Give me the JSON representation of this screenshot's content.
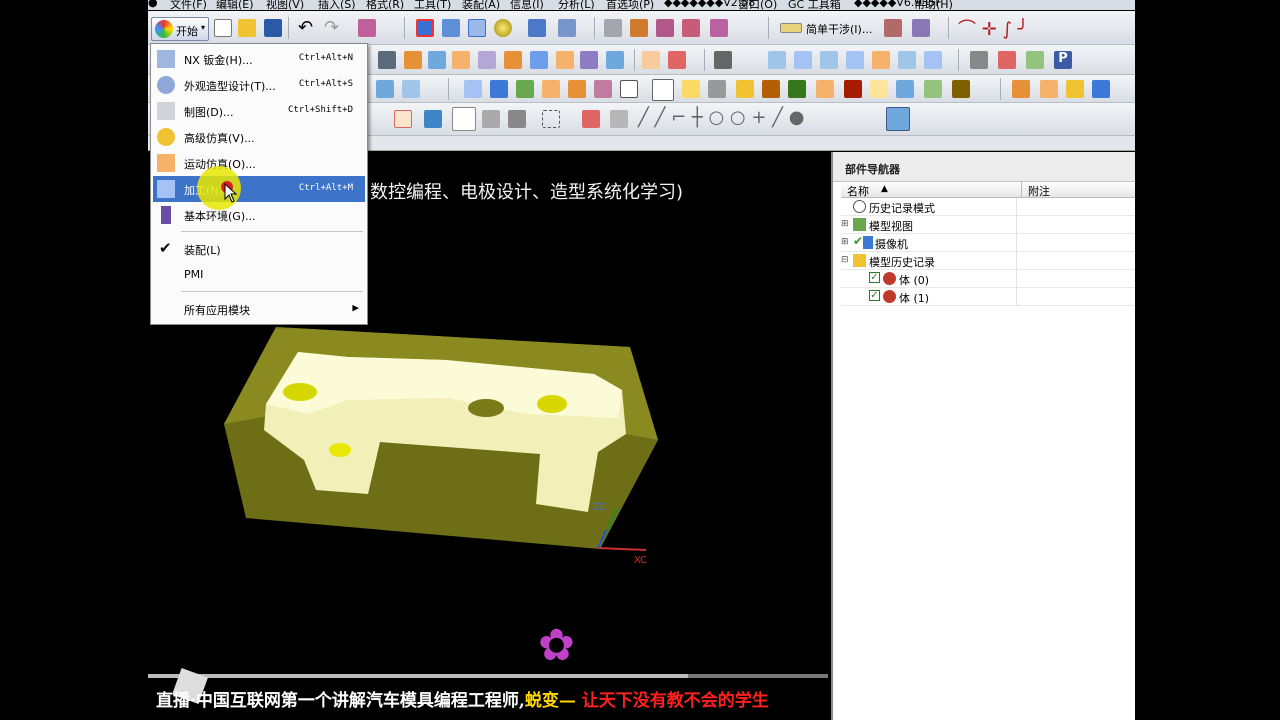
{
  "menubar": {
    "items": [
      "文件(F)",
      "编辑(E)",
      "视图(V)",
      "插入(S)",
      "格式(R)",
      "工具(T)",
      "装配(A)",
      "信息(I)",
      "分析(L)",
      "首选项(P)",
      "◆◆◆◆◆◆◆V2.58",
      "窗口(O)",
      "GC 工具箱",
      "◆◆◆◆◆V6.935F",
      "帮助(H)"
    ]
  },
  "toolbar": {
    "start_label": "开始",
    "selection_filter": "简单干涉(I)..."
  },
  "start_menu": {
    "items": [
      {
        "label": "NX 钣金(H)...",
        "shortcut": "Ctrl+Alt+N"
      },
      {
        "label": "外观造型设计(T)...",
        "shortcut": "Ctrl+Alt+S"
      },
      {
        "label": "制图(D)...",
        "shortcut": "Ctrl+Shift+D"
      },
      {
        "label": "高级仿真(V)...",
        "shortcut": ""
      },
      {
        "label": "运动仿真(O)...",
        "shortcut": ""
      },
      {
        "label": "加工(N)...",
        "shortcut": "Ctrl+Alt+M"
      },
      {
        "label": "基本环境(G)...",
        "shortcut": ""
      },
      {
        "label": "装配(L)",
        "shortcut": ""
      },
      {
        "label": "PMI",
        "shortcut": ""
      },
      {
        "label": "所有应用模块",
        "shortcut": ""
      }
    ],
    "submenu_arrow": "▶",
    "checkmark": "✔"
  },
  "viewport": {
    "title": "数控编程、电极设计、造型系统化学习)",
    "axis_x": "XC",
    "axis_z": "ZC",
    "subtitle_prefix": "直播·中国互联网第一个讲解汽车模具编程工程师,",
    "subtitle_name": "蜕变",
    "subtitle_dash": "—",
    "subtitle_slogan": "让天下没有教不会的学生"
  },
  "navigator": {
    "title": "部件导航器",
    "col_name": "名称",
    "col_note": "附注",
    "sort_glyph": "▲",
    "rows": [
      {
        "label": "历史记录模式"
      },
      {
        "label": "模型视图"
      },
      {
        "label": "摄像机"
      },
      {
        "label": "模型历史记录"
      },
      {
        "label": "体 (0)"
      },
      {
        "label": "体 (1)"
      }
    ]
  },
  "colors": {
    "selection": "#3d73c8",
    "model_body": "#f0f0b8",
    "blank_box": "#8a8a20"
  }
}
